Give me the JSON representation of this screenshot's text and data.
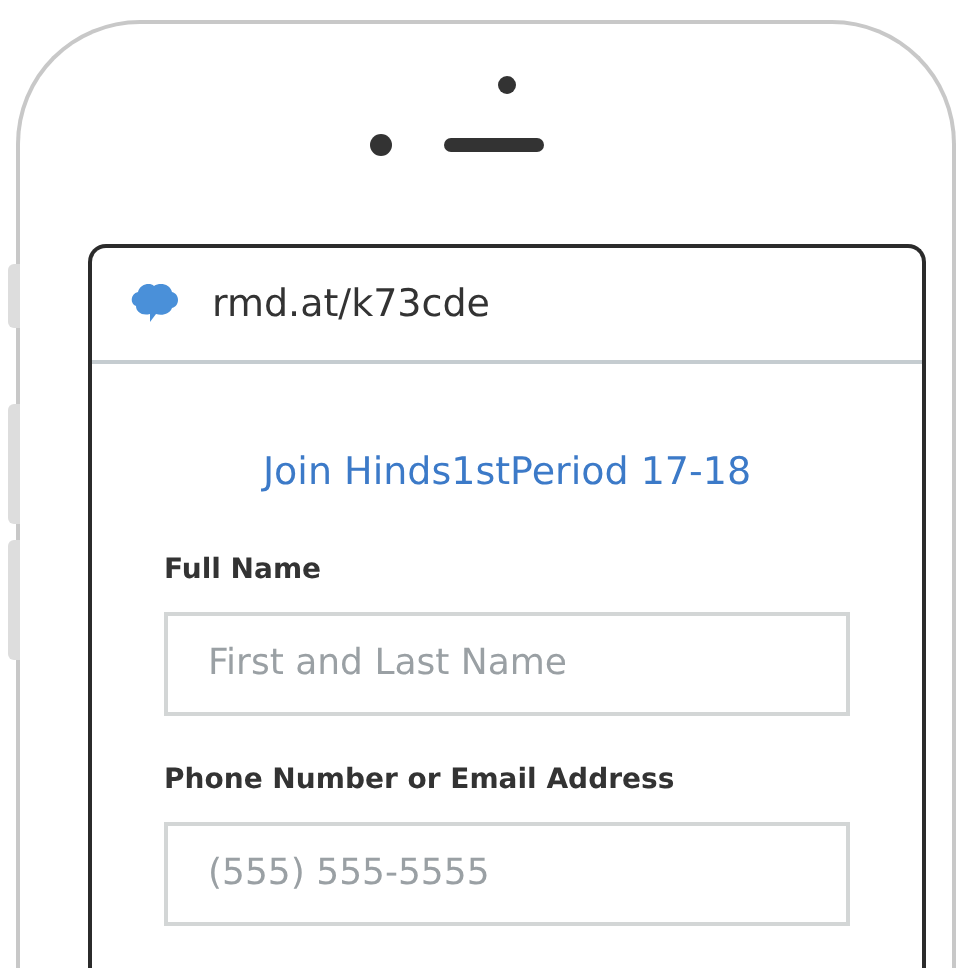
{
  "browser": {
    "url": "rmd.at/k73cde"
  },
  "form": {
    "title": "Join Hinds1stPeriod 17-18",
    "fields": [
      {
        "label": "Full Name",
        "placeholder": "First and Last Name"
      },
      {
        "label": "Phone Number or Email Address",
        "placeholder": "(555) 555-5555"
      }
    ]
  }
}
